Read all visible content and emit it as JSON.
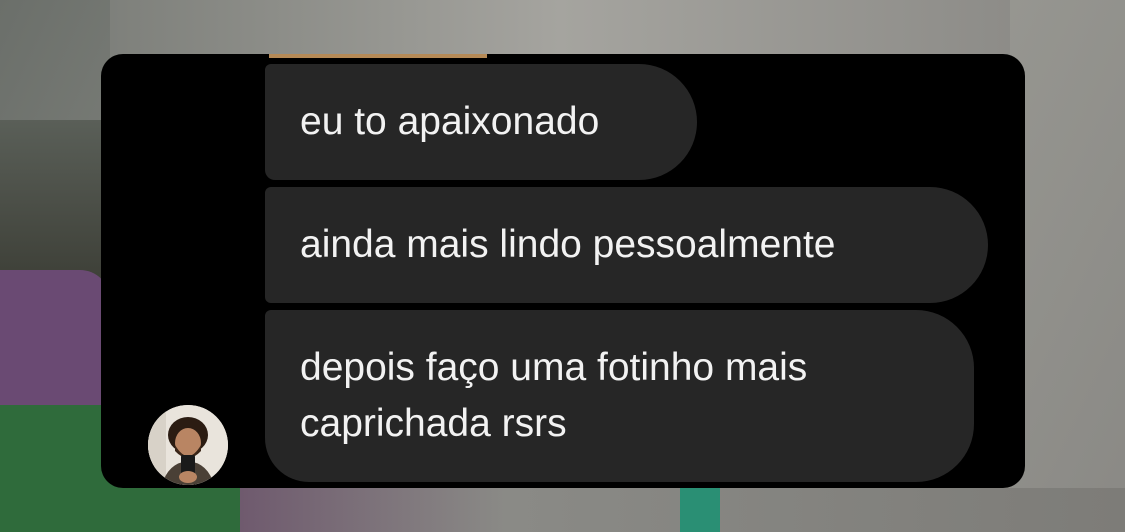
{
  "conversation": {
    "messages": [
      {
        "text": "eu to apaixonado"
      },
      {
        "text": "ainda mais lindo pessoalmente"
      },
      {
        "text": "depois faço uma fotinho mais caprichada rsrs",
        "lines": [
          "depois faço uma fotinho mais",
          "caprichada rsrs"
        ]
      }
    ]
  },
  "avatar": {
    "icon": "user-avatar"
  },
  "colors": {
    "panel_background": "#000000",
    "bubble_background": "#262626",
    "bubble_text": "#f2f2f2"
  }
}
